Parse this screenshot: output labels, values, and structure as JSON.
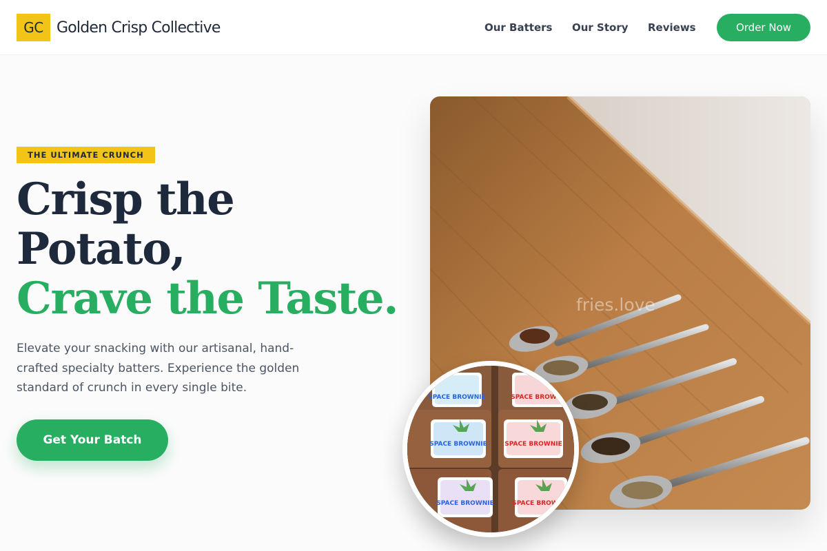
{
  "brand": {
    "logo_text": "GC",
    "name": "Golden Crisp Collective"
  },
  "nav": {
    "links": [
      "Our Batters",
      "Our Story",
      "Reviews"
    ],
    "cta_label": "Order Now"
  },
  "hero": {
    "badge": "THE ULTIMATE CRUNCH",
    "headline_line1": "Crisp the",
    "headline_line2": "Potato,",
    "headline_accent": "Crave the Taste.",
    "lead": "Elevate your snacking with our artisanal, hand-crafted specialty batters. Experience the golden standard of crunch in every single bite.",
    "cta_label": "Get Your Batch"
  },
  "images": {
    "main_watermark": "fries.love",
    "inset_label": "SPACE BROWNIE"
  },
  "colors": {
    "accent_green": "#27ae60",
    "accent_yellow": "#f2c417",
    "heading_dark": "#1e293b"
  }
}
